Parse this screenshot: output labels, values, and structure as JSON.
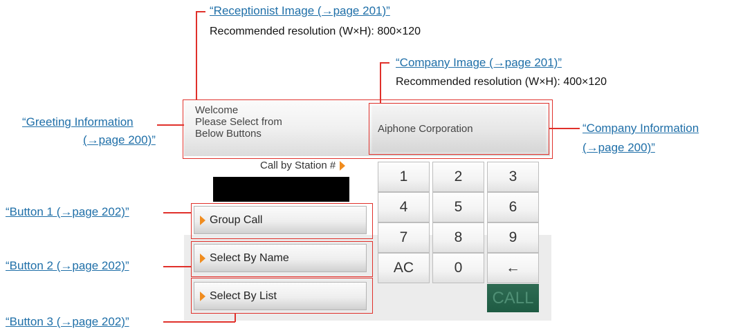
{
  "callouts": {
    "receptionist_image": "“Receptionist Image (→page 201)”",
    "receptionist_res": "Recommended resolution (W×H): 800×120",
    "company_image": "“Company Image (→page 201)”",
    "company_res": "Recommended resolution (W×H): 400×120",
    "greeting_info_1": "“Greeting Information",
    "greeting_info_2": "(→page 200)”",
    "company_info_1": "“Company Information",
    "company_info_2": "(→page 200)”",
    "button1": "“Button 1 (→page 202)”",
    "button2": "“Button 2 (→page 202)”",
    "button3": "“Button 3 (→page 202)”"
  },
  "screen": {
    "greeting": "Welcome\nPlease Select from\nBelow Buttons",
    "company_name": "Aiphone Corporation",
    "call_by_station": "Call by Station #",
    "buttons": [
      {
        "label": "Group Call"
      },
      {
        "label": "Select By Name"
      },
      {
        "label": "Select By List"
      }
    ],
    "keypad": [
      "1",
      "2",
      "3",
      "4",
      "5",
      "6",
      "7",
      "8",
      "9",
      "AC",
      "0",
      "←"
    ],
    "call_label": "CALL"
  },
  "colors": {
    "callout_line": "#e0302a",
    "link_text": "#1f6fa8",
    "arrow_accent": "#f08c1e",
    "call_button": "#1e5b43"
  }
}
